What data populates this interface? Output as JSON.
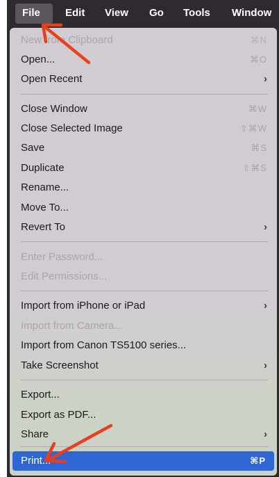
{
  "menubar": {
    "items": [
      "File",
      "Edit",
      "View",
      "Go",
      "Tools",
      "Window"
    ]
  },
  "menu": {
    "items": [
      {
        "label": "New from Clipboard",
        "shortcut": "⌘N",
        "disabled": true
      },
      {
        "label": "Open...",
        "shortcut": "⌘O",
        "disabled": false
      },
      {
        "label": "Open Recent",
        "submenu": true
      },
      {
        "label": "Close Window",
        "shortcut": "⌘W"
      },
      {
        "label": "Close Selected Image",
        "shortcut": "⇧⌘W"
      },
      {
        "label": "Save",
        "shortcut": "⌘S"
      },
      {
        "label": "Duplicate",
        "shortcut": "⇧⌘S"
      },
      {
        "label": "Rename..."
      },
      {
        "label": "Move To..."
      },
      {
        "label": "Revert To",
        "submenu": true
      },
      {
        "label": "Enter Password...",
        "disabled": true
      },
      {
        "label": "Edit Permissions...",
        "disabled": true
      },
      {
        "label": "Import from iPhone or iPad",
        "submenu": true
      },
      {
        "label": "Import from Camera...",
        "disabled": true
      },
      {
        "label": "Import from Canon TS5100 series..."
      },
      {
        "label": "Take Screenshot",
        "submenu": true
      },
      {
        "label": "Export..."
      },
      {
        "label": "Export as PDF..."
      },
      {
        "label": "Share",
        "submenu": true
      },
      {
        "label": "Print...",
        "shortcut": "⌘P",
        "highlighted": true
      }
    ],
    "chevron": "›"
  },
  "colors": {
    "menubar": "#2e2a30",
    "highlight": "#2f66d3",
    "arrow": "#e8401e"
  },
  "icons": [
    "red-arrow-annotation"
  ]
}
